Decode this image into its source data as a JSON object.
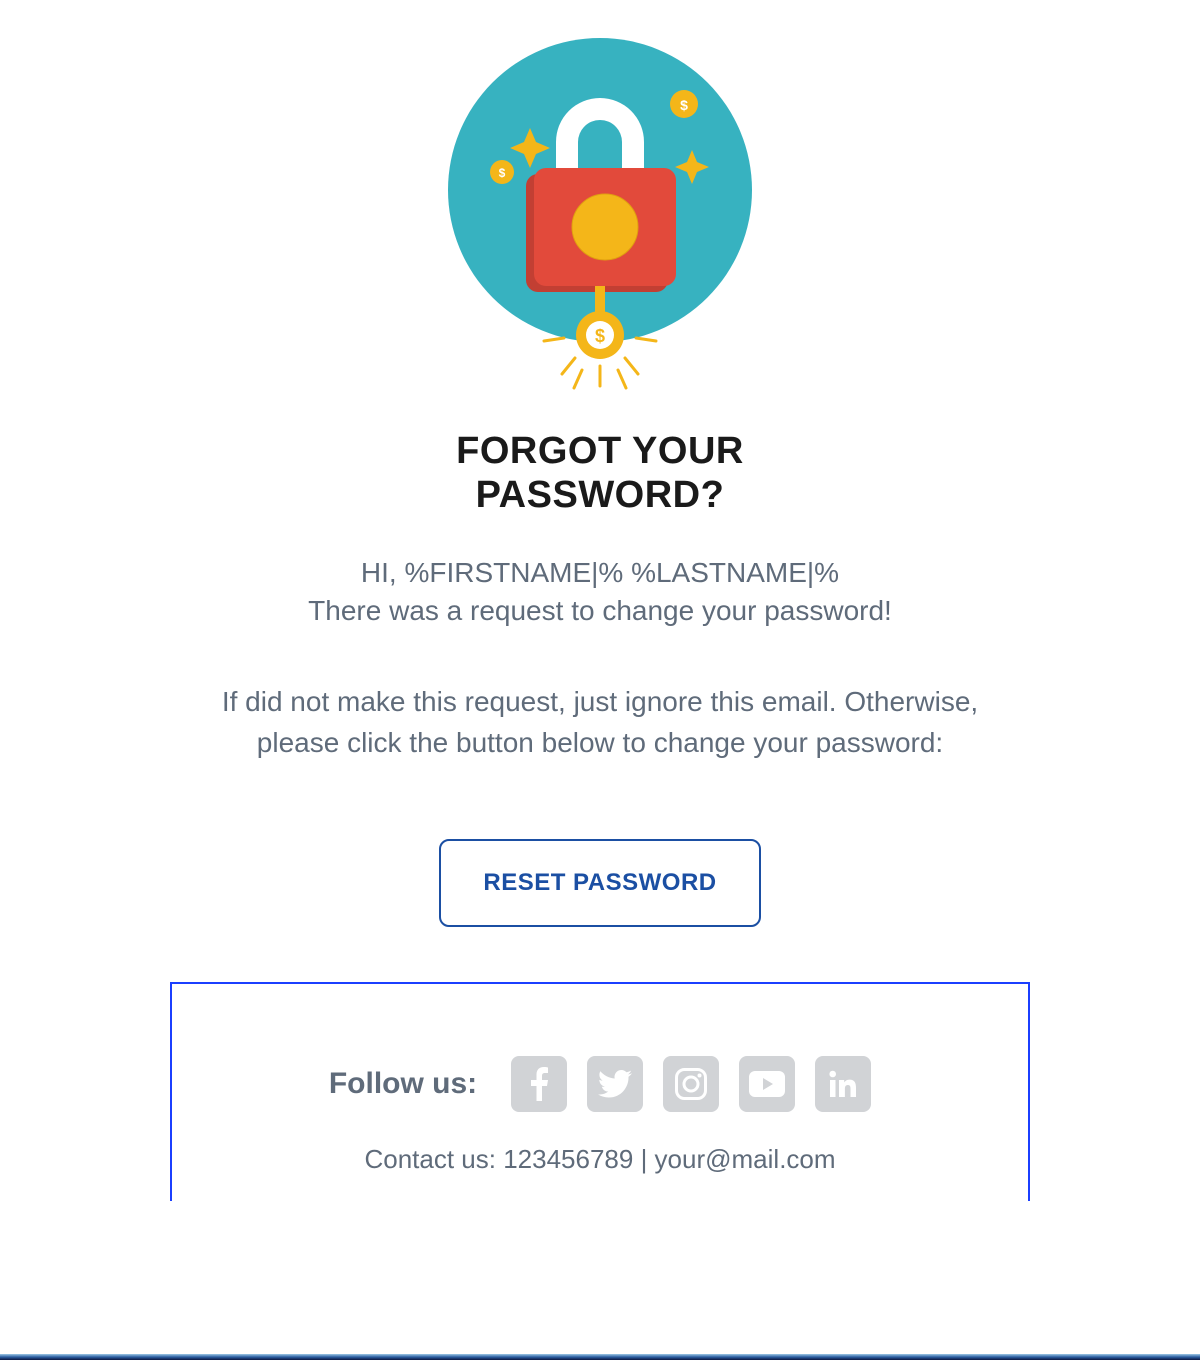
{
  "title": "FORGOT YOUR PASSWORD?",
  "greeting": "HI, %FIRSTNAME|% %LASTNAME|%",
  "intro": "There was a request to change your password!",
  "body": "If did not make this request, just ignore this email. Otherwise, please click the button below to change your password:",
  "button_label": "RESET PASSWORD",
  "footer": {
    "follow_label": "Follow us:",
    "contact_prefix": "Contact us: ",
    "phone": "123456789",
    "separator": " | ",
    "email": "your@mail.com"
  },
  "social": [
    "facebook",
    "twitter",
    "instagram",
    "youtube",
    "linkedin"
  ],
  "colors": {
    "accent": "#1b4fa3",
    "text_muted": "#5f6b7a",
    "hero_circle": "#37b2c0",
    "lock_body": "#e24a3b",
    "lock_body_shadow": "#c23f33",
    "gold": "#f4b619",
    "social_bg": "#d1d3d6"
  }
}
